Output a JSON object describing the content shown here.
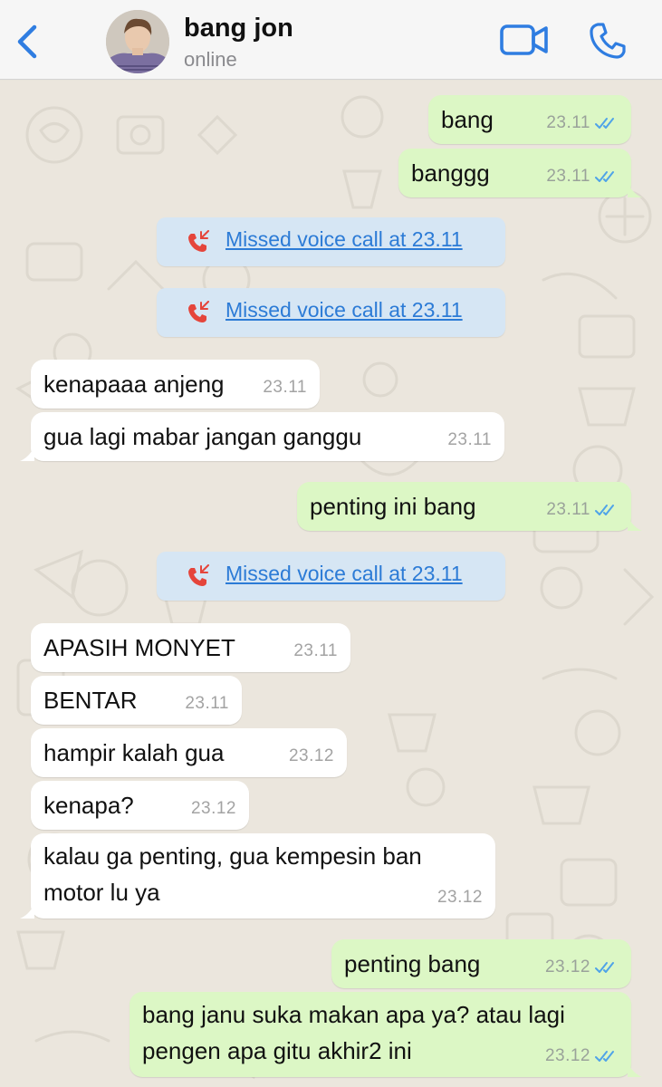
{
  "header": {
    "contact_name": "bang jon",
    "status": "online"
  },
  "messages": [
    {
      "text": "bang",
      "time": "23.11"
    },
    {
      "text": "banggg",
      "time": "23.11"
    },
    {
      "text": "kenapaaa anjeng",
      "time": "23.11"
    },
    {
      "text": "gua lagi mabar jangan ganggu",
      "time": "23.11"
    },
    {
      "text": "penting ini bang",
      "time": "23.11"
    },
    {
      "text": "APASIH MONYET",
      "time": "23.11"
    },
    {
      "text": "BENTAR",
      "time": "23.11"
    },
    {
      "text": "hampir kalah gua",
      "time": "23.12"
    },
    {
      "text": "kenapa?",
      "time": "23.12"
    },
    {
      "text_line1": "kalau ga penting, gua kempesin ban",
      "text_line2": "motor lu ya",
      "time": "23.12"
    },
    {
      "text": "penting bang",
      "time": "23.12"
    },
    {
      "text_line1": "bang janu suka makan apa ya? atau lagi",
      "text_line2": "pengen apa gitu akhir2 ini",
      "time": "23.12"
    }
  ],
  "missed_calls": [
    {
      "label": "Missed voice call at 23.11"
    },
    {
      "label": "Missed voice call at 23.11"
    },
    {
      "label": "Missed voice call at 23.11"
    }
  ],
  "icons": {
    "back": "chevron-left-icon",
    "video": "video-camera-icon",
    "call": "phone-icon",
    "missed": "missed-call-icon",
    "read": "double-check-icon"
  },
  "colors": {
    "accent": "#2f7de1",
    "outgoing_bubble": "#dcf7c5",
    "incoming_bubble": "#ffffff",
    "missed_call_bg": "#d6e6f4",
    "missed_call_icon": "#e5453b",
    "read_ticks": "#4fa3e8"
  }
}
